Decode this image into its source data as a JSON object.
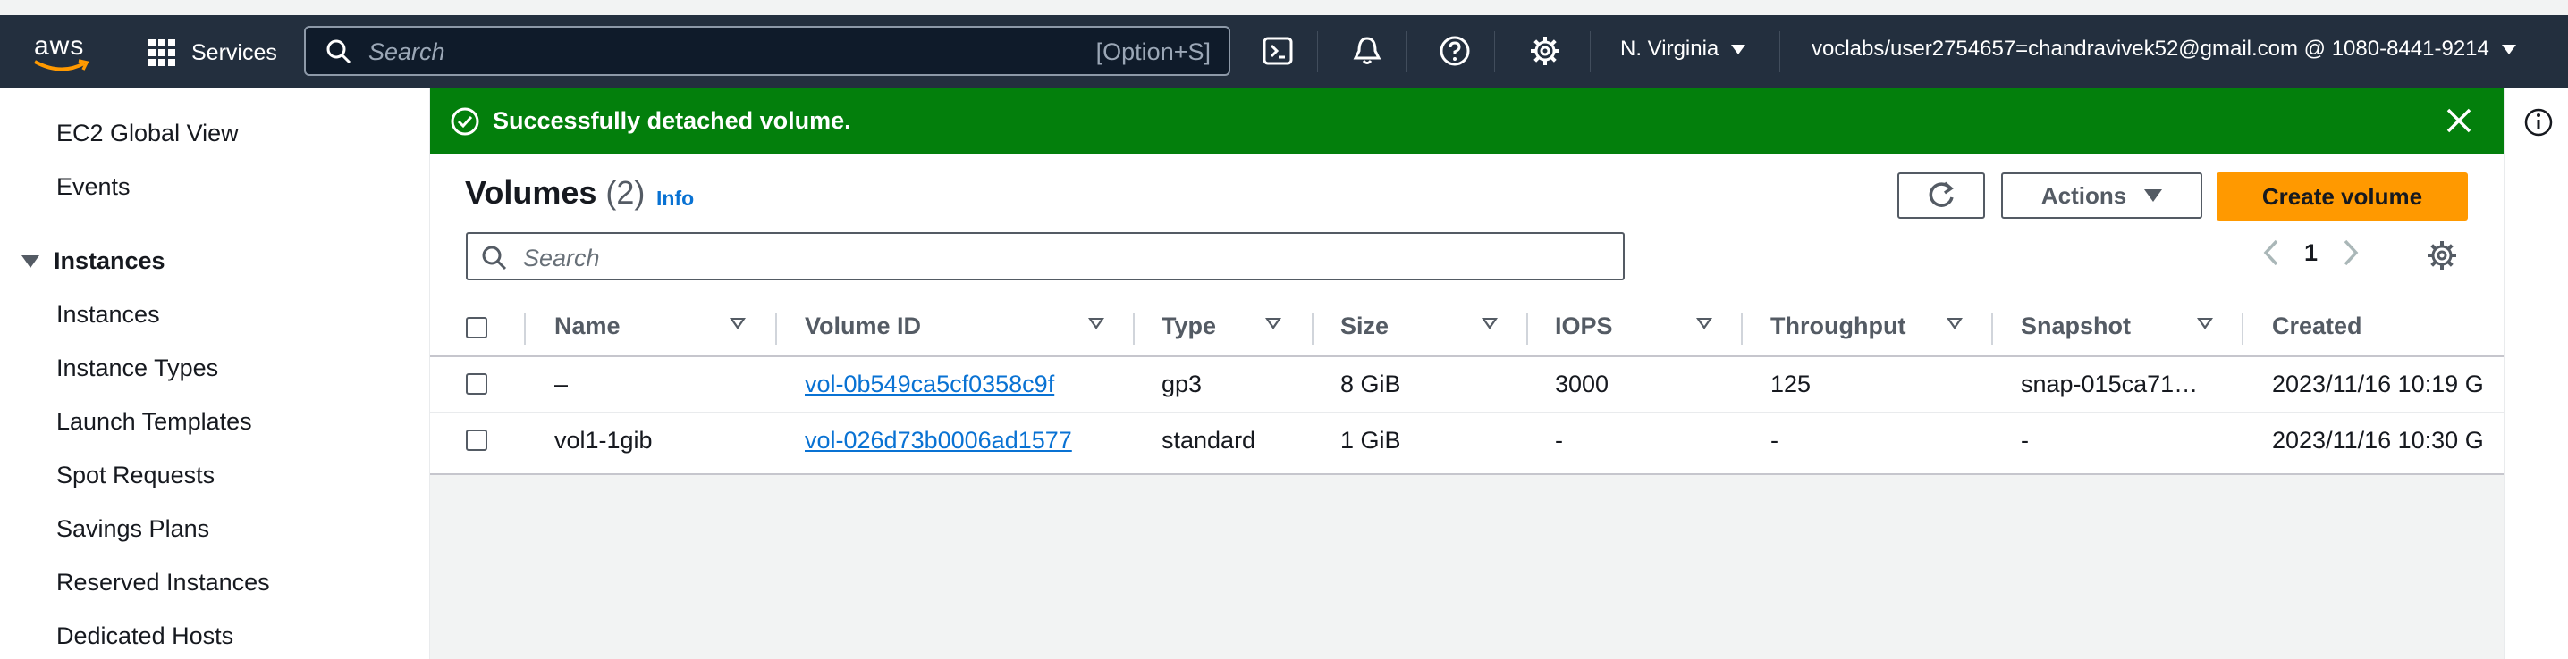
{
  "nav": {
    "logo_text": "aws",
    "services_label": "Services",
    "search_placeholder": "Search",
    "search_shortcut": "[Option+S]",
    "region": "N. Virginia",
    "account": "voclabs/user2754657=chandravivek52@gmail.com @ 1080-8441-9214",
    "icons": [
      "cloudshell-icon",
      "bell-icon",
      "help-icon",
      "gear-icon"
    ]
  },
  "sidebar": {
    "items_top": [
      "EC2 Global View",
      "Events"
    ],
    "section": "Instances",
    "items": [
      "Instances",
      "Instance Types",
      "Launch Templates",
      "Spot Requests",
      "Savings Plans",
      "Reserved Instances",
      "Dedicated Hosts"
    ]
  },
  "flash": {
    "message": "Successfully detached volume.",
    "color": "#037f0c"
  },
  "panel": {
    "title": "Volumes",
    "count": "(2)",
    "info": "Info",
    "actions_label": "Actions",
    "create_label": "Create volume",
    "search_placeholder": "Search",
    "page": "1"
  },
  "table": {
    "columns": [
      "Name",
      "Volume ID",
      "Type",
      "Size",
      "IOPS",
      "Throughput",
      "Snapshot",
      "Created"
    ],
    "rows": [
      {
        "name": "–",
        "volume_id": "vol-0b549ca5cf0358c9f",
        "type": "gp3",
        "size": "8 GiB",
        "iops": "3000",
        "throughput": "125",
        "snapshot": "snap-015ca71…",
        "created": "2023/11/16 10:19 G"
      },
      {
        "name": "vol1-1gib",
        "volume_id": "vol-026d73b0006ad1577",
        "type": "standard",
        "size": "1 GiB",
        "iops": "-",
        "throughput": "-",
        "snapshot": "-",
        "created": "2023/11/16 10:30 G"
      }
    ]
  },
  "colors": {
    "navbar": "#232f3e",
    "accent_orange": "#ff9900",
    "link_blue": "#0972d3"
  }
}
